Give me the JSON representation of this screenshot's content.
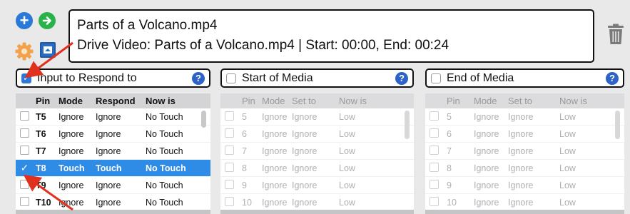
{
  "title": {
    "file_name": "Parts of a Volcano.mp4",
    "description": "Drive Video: Parts of a Volcano.mp4 | Start: 00:00, End: 00:24"
  },
  "icons": {
    "add": "plus-icon",
    "go": "arrow-right-icon",
    "settings": "gear-icon",
    "display": "display-icon",
    "delete": "trash-icon",
    "help_glyph": "?"
  },
  "colors": {
    "accent_blue": "#2e8be6",
    "add_blue": "#2a79d8",
    "go_green": "#29b24a",
    "gear_orange": "#f2a24b",
    "arrow_red": "#e0301e"
  },
  "panels": {
    "input": {
      "label": "Input to Respond to",
      "checked": true,
      "columns": [
        "Pin",
        "Mode",
        "Respond",
        "Now is"
      ],
      "rows": [
        {
          "pin": "T5",
          "mode": "Ignore",
          "respond": "Ignore",
          "now": "No Touch",
          "selected": false
        },
        {
          "pin": "T6",
          "mode": "Ignore",
          "respond": "Ignore",
          "now": "No Touch",
          "selected": false
        },
        {
          "pin": "T7",
          "mode": "Ignore",
          "respond": "Ignore",
          "now": "No Touch",
          "selected": false
        },
        {
          "pin": "T8",
          "mode": "Touch",
          "respond": "Touch",
          "now": "No Touch",
          "selected": true
        },
        {
          "pin": "T9",
          "mode": "Ignore",
          "respond": "Ignore",
          "now": "No Touch",
          "selected": false
        },
        {
          "pin": "T10",
          "mode": "Ignore",
          "respond": "Ignore",
          "now": "No Touch",
          "selected": false
        }
      ]
    },
    "start": {
      "label": "Start of Media",
      "checked": false,
      "columns": [
        "Pin",
        "Mode",
        "Set to",
        "Now is"
      ],
      "rows": [
        {
          "pin": "5",
          "mode": "Ignore",
          "set": "Ignore",
          "now": "Low"
        },
        {
          "pin": "6",
          "mode": "Ignore",
          "set": "Ignore",
          "now": "Low"
        },
        {
          "pin": "7",
          "mode": "Ignore",
          "set": "Ignore",
          "now": "Low"
        },
        {
          "pin": "8",
          "mode": "Ignore",
          "set": "Ignore",
          "now": "Low"
        },
        {
          "pin": "9",
          "mode": "Ignore",
          "set": "Ignore",
          "now": "Low"
        },
        {
          "pin": "10",
          "mode": "Ignore",
          "set": "Ignore",
          "now": "Low"
        }
      ]
    },
    "end": {
      "label": "End of Media",
      "checked": false,
      "columns": [
        "Pin",
        "Mode",
        "Set to",
        "Now is"
      ],
      "rows": [
        {
          "pin": "5",
          "mode": "Ignore",
          "set": "Ignore",
          "now": "Low"
        },
        {
          "pin": "6",
          "mode": "Ignore",
          "set": "Ignore",
          "now": "Low"
        },
        {
          "pin": "7",
          "mode": "Ignore",
          "set": "Ignore",
          "now": "Low"
        },
        {
          "pin": "8",
          "mode": "Ignore",
          "set": "Ignore",
          "now": "Low"
        },
        {
          "pin": "9",
          "mode": "Ignore",
          "set": "Ignore",
          "now": "Low"
        },
        {
          "pin": "10",
          "mode": "Ignore",
          "set": "Ignore",
          "now": "Low"
        }
      ]
    }
  }
}
